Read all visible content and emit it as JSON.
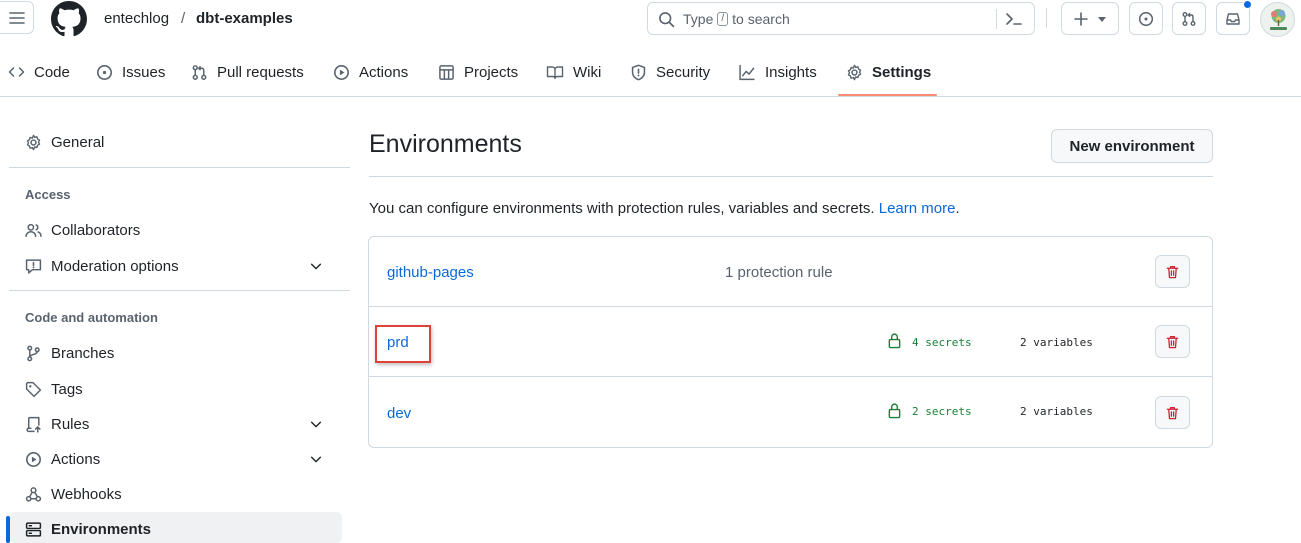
{
  "header": {
    "owner": "entechlog",
    "separator": "/",
    "repo": "dbt-examples",
    "search": {
      "prefix": "Type",
      "key": "/",
      "suffix": "to search"
    }
  },
  "nav": {
    "tabs": [
      {
        "label": "Code",
        "icon": "code-icon"
      },
      {
        "label": "Issues",
        "icon": "issue-icon"
      },
      {
        "label": "Pull requests",
        "icon": "pull-request-icon"
      },
      {
        "label": "Actions",
        "icon": "play-icon"
      },
      {
        "label": "Projects",
        "icon": "table-icon"
      },
      {
        "label": "Wiki",
        "icon": "book-icon"
      },
      {
        "label": "Security",
        "icon": "shield-icon"
      },
      {
        "label": "Insights",
        "icon": "graph-icon"
      },
      {
        "label": "Settings",
        "icon": "gear-icon",
        "selected": true
      }
    ]
  },
  "sidebar": {
    "general": "General",
    "access_heading": "Access",
    "collaborators": "Collaborators",
    "moderation": "Moderation options",
    "code_heading": "Code and automation",
    "branches": "Branches",
    "tags": "Tags",
    "rules": "Rules",
    "actions": "Actions",
    "webhooks": "Webhooks",
    "environments": "Environments"
  },
  "main": {
    "title": "Environments",
    "new_button": "New environment",
    "description": "You can configure environments with protection rules, variables and secrets.",
    "learn_more": "Learn more",
    "environments": [
      {
        "name": "github-pages",
        "rule": "1 protection rule"
      },
      {
        "name": "prd",
        "secrets": "4 secrets",
        "variables": "2 variables"
      },
      {
        "name": "dev",
        "secrets": "2 secrets",
        "variables": "2 variables"
      }
    ]
  },
  "colors": {
    "accent": "#0969da",
    "success": "#1a7f37",
    "danger": "#cf222e",
    "tab_underline": "#fd8c73",
    "highlight": "#e0403a"
  }
}
